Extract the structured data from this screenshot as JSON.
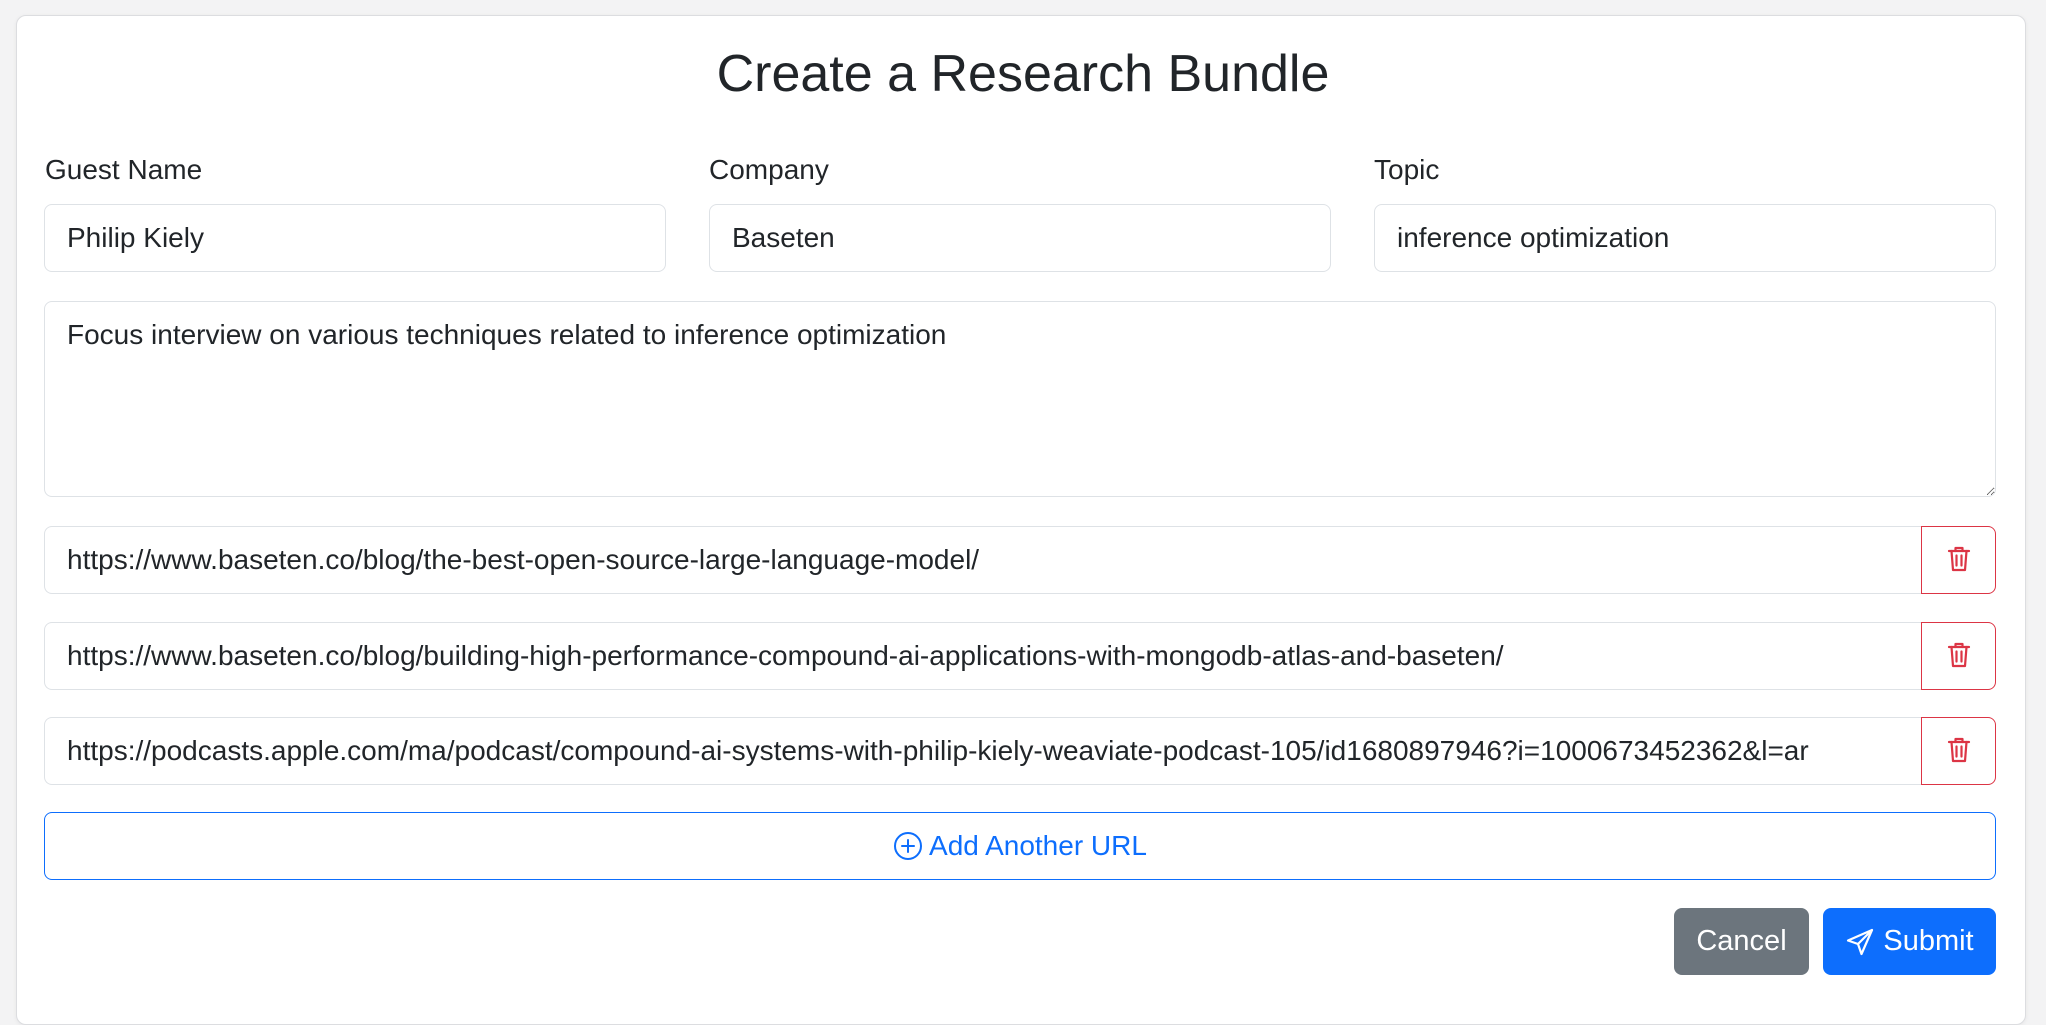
{
  "form": {
    "title": "Create a Research Bundle",
    "guest_name": {
      "label": "Guest Name",
      "value": "Philip Kiely"
    },
    "company": {
      "label": "Company",
      "value": "Baseten"
    },
    "topic": {
      "label": "Topic",
      "value": "inference optimization"
    },
    "notes": {
      "value": "Focus interview on various techniques related to inference optimization"
    },
    "urls": [
      "https://www.baseten.co/blog/the-best-open-source-large-language-model/",
      "https://www.baseten.co/blog/building-high-performance-compound-ai-applications-with-mongodb-atlas-and-baseten/",
      "https://podcasts.apple.com/ma/podcast/compound-ai-systems-with-philip-kiely-weaviate-podcast-105/id1680897946?i=1000673452362&l=ar"
    ],
    "add_url_label": "Add Another URL",
    "cancel_label": "Cancel",
    "submit_label": "Submit"
  },
  "icons": {
    "delete": "trash-icon",
    "add": "plus-circle-icon",
    "submit": "send-icon"
  },
  "colors": {
    "primary": "#0d6efd",
    "danger": "#dc3545",
    "secondary": "#6c757d"
  }
}
